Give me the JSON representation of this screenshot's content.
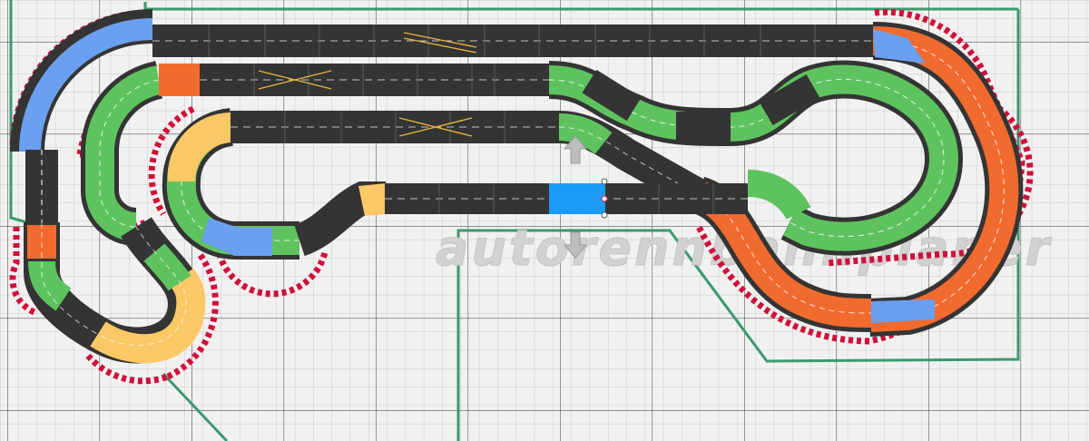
{
  "app": {
    "watermark": "autorennbahnplaner"
  },
  "colors": {
    "background": "#f1f1f1",
    "grid_minor": "#c9c9c9",
    "grid_major": "#555555",
    "boundary": "#3a9a6e",
    "track_straight": "#343434",
    "track_green": "#5ec35e",
    "track_orange": "#f26b2e",
    "track_blue": "#6b9ff0",
    "track_yellow": "#fbc866",
    "selected_piece": "#1a9bf5",
    "lane_line": "#ffffff",
    "curb_red": "#d0103a"
  },
  "icons": {
    "move_up": "arrow-up-icon",
    "move_down": "arrow-down-icon",
    "crossing": "lane-crossover-icon",
    "connector": "connection-handle-icon"
  }
}
